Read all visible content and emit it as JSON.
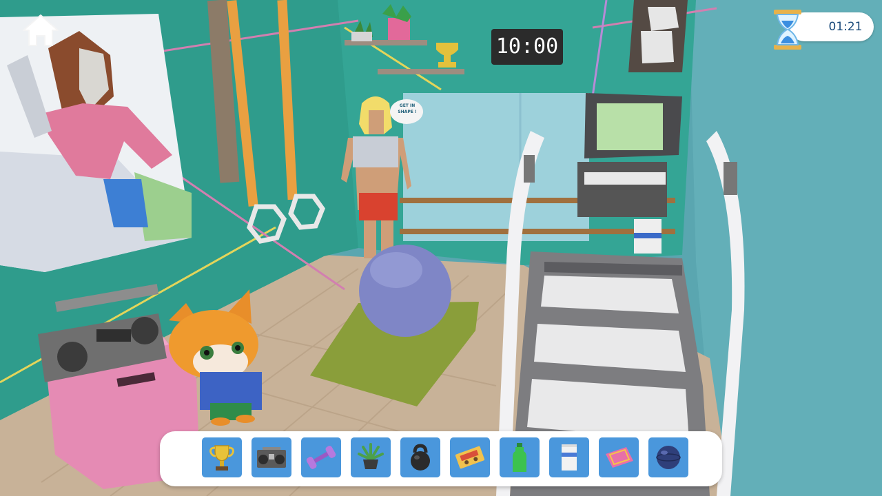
{
  "hud": {
    "home_icon": "home-icon",
    "timer_icon": "hourglass-icon",
    "timer_value": "01:21"
  },
  "scene": {
    "wall_clock": "10:00",
    "poster_speech": "GET IN SHAPE !"
  },
  "inventory": {
    "items": [
      {
        "name": "trophy",
        "icon": "trophy-icon"
      },
      {
        "name": "boombox",
        "icon": "boombox-icon"
      },
      {
        "name": "dumbbell",
        "icon": "dumbbell-icon"
      },
      {
        "name": "potted plant",
        "icon": "plant-icon"
      },
      {
        "name": "kettlebell",
        "icon": "kettlebell-icon"
      },
      {
        "name": "cassette tape",
        "icon": "cassette-icon"
      },
      {
        "name": "water bottle",
        "icon": "bottle-icon"
      },
      {
        "name": "towel",
        "icon": "towel-icon"
      },
      {
        "name": "pink mat",
        "icon": "mat-icon"
      },
      {
        "name": "exercise ball",
        "icon": "ball-icon"
      }
    ]
  },
  "colors": {
    "wall": "#2e9e8e",
    "floor": "#c9b39a",
    "slot_bg": "#4a97dc",
    "timer_text": "#1a4a7a"
  }
}
